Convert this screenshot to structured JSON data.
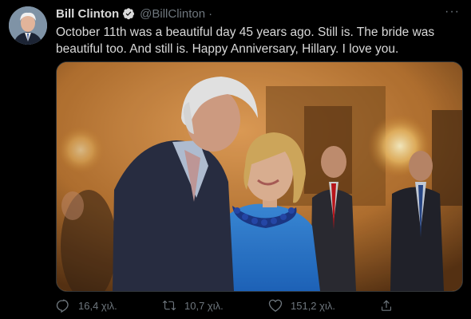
{
  "tweet": {
    "author_name": "Bill Clinton",
    "handle": "@BillClinton",
    "separator": "·",
    "more_label": "···",
    "text": "October 11th was a beautiful day 45 years ago. Still is. The bride was beautiful too. And still is. Happy Anniversary, Hillary. I love you."
  },
  "actions": {
    "replies": "16,4 χιλ.",
    "retweets": "10,7 χιλ.",
    "likes": "151,2 χιλ."
  },
  "icons": {
    "verified": "verified-badge-icon",
    "reply": "reply-icon",
    "retweet": "retweet-icon",
    "like": "heart-icon",
    "share": "share-icon",
    "more": "more-dots-icon"
  },
  "colors": {
    "background": "#000000",
    "text": "#d9d9d9",
    "muted": "#6e767d",
    "verified": "#d9d9d9"
  }
}
